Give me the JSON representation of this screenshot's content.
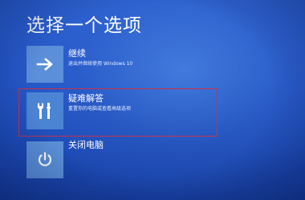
{
  "title": "选择一个选项",
  "options": [
    {
      "title": "继续",
      "description": "退出并继续使用 Windows 10",
      "icon": "arrow-right-icon"
    },
    {
      "title": "疑难解答",
      "description": "重置你的电脑或查看高级选项",
      "icon": "tools-icon"
    },
    {
      "title": "关闭电脑",
      "icon": "power-icon"
    }
  ],
  "colors": {
    "background": "#2457c8",
    "tile": "#4f86d6",
    "text": "#ffffff",
    "highlight": "#c8324c"
  }
}
